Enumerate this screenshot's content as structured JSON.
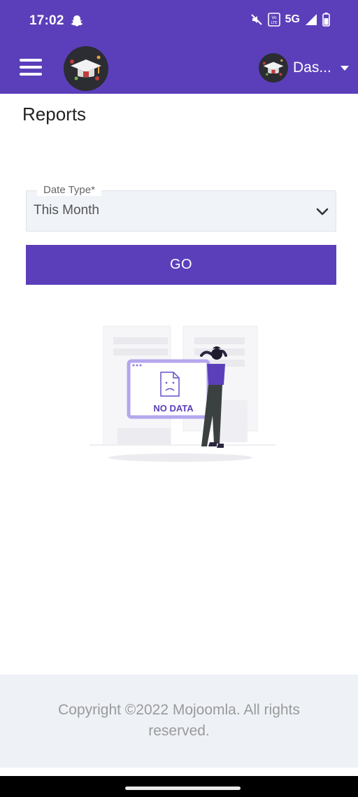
{
  "status_bar": {
    "time": "17:02",
    "network": "5G",
    "icons": [
      "snapchat-icon",
      "mute-icon",
      "volte-icon",
      "signal-icon",
      "battery-icon"
    ]
  },
  "app_bar": {
    "menu_icon": "hamburger-icon",
    "user_name": "Das...",
    "colors": {
      "primary": "#5b3fba"
    }
  },
  "page": {
    "title": "Reports"
  },
  "filter": {
    "label": "Date Type*",
    "value": "This Month",
    "chevron_icon": "chevron-down-icon"
  },
  "go_button": {
    "label": "GO"
  },
  "empty_state": {
    "image_text": "NO DATA"
  },
  "footer": {
    "copyright": "Copyright ©2022 Mojoomla. All rights reserved."
  }
}
